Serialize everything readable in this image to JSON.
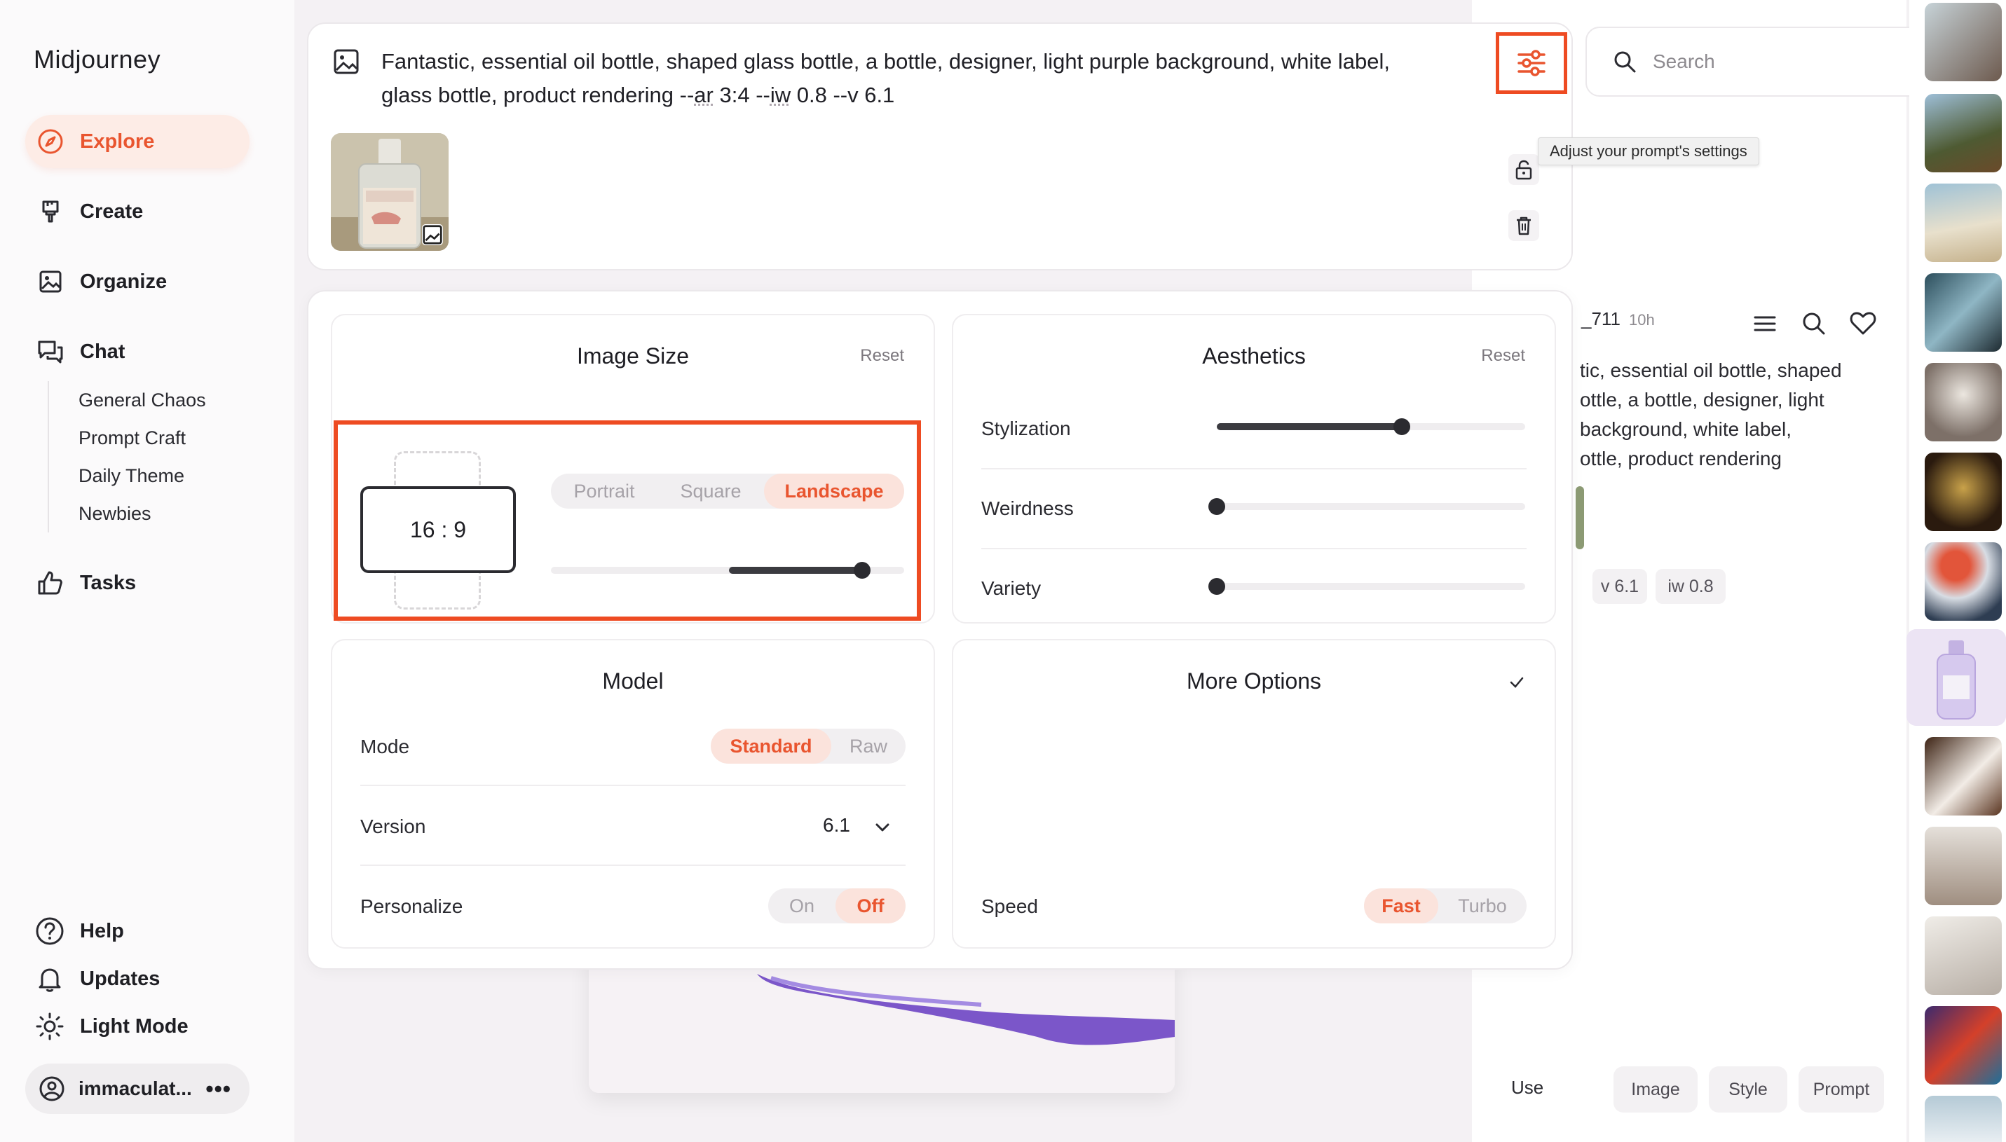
{
  "app": {
    "title": "Midjourney"
  },
  "sidebar": {
    "items": [
      {
        "label": "Explore",
        "icon": "compass-icon",
        "active": true
      },
      {
        "label": "Create",
        "icon": "brush-icon"
      },
      {
        "label": "Organize",
        "icon": "image-icon"
      },
      {
        "label": "Chat",
        "icon": "chat-icon"
      },
      {
        "label": "Tasks",
        "icon": "thumbs-up-icon"
      }
    ],
    "chat_channels": [
      "General Chaos",
      "Prompt Craft",
      "Daily Theme",
      "Newbies"
    ],
    "bottom": [
      {
        "label": "Help",
        "icon": "help-icon"
      },
      {
        "label": "Updates",
        "icon": "bell-icon"
      },
      {
        "label": "Light Mode",
        "icon": "sun-icon"
      }
    ],
    "user": {
      "name": "immaculat...",
      "more": "•••"
    }
  },
  "prompt": {
    "line1": "Fantastic, essential oil bottle, shaped glass bottle, a bottle, designer, light purple background, white label,",
    "line2_a": "glass bottle, product rendering --",
    "line2_ar": "ar",
    "line2_b": " 3:4 --",
    "line2_iw": "iw",
    "line2_c": " 0.8 --v 6.1",
    "tooltip": "Adjust your prompt's settings"
  },
  "search": {
    "placeholder": "Search"
  },
  "image_size": {
    "title": "Image Size",
    "reset": "Reset",
    "ratio": "16 : 9",
    "orientations": [
      "Portrait",
      "Square",
      "Landscape"
    ],
    "selected": "Landscape",
    "slider_value": 0.88
  },
  "aesthetics": {
    "title": "Aesthetics",
    "reset": "Reset",
    "sliders": [
      {
        "label": "Stylization",
        "value": 0.6
      },
      {
        "label": "Weirdness",
        "value": 0.0
      },
      {
        "label": "Variety",
        "value": 0.0
      }
    ]
  },
  "model": {
    "title": "Model",
    "mode_label": "Mode",
    "mode_options": [
      "Standard",
      "Raw"
    ],
    "mode_selected": "Standard",
    "version_label": "Version",
    "version_value": "6.1",
    "personalize_label": "Personalize",
    "personalize_options": [
      "On",
      "Off"
    ],
    "personalize_selected": "Off"
  },
  "more_options": {
    "title": "More Options",
    "speed_label": "Speed",
    "speed_options": [
      "Fast",
      "Turbo"
    ],
    "speed_selected": "Fast"
  },
  "detail": {
    "user_suffix": "_711",
    "time": "10h",
    "prompt_lines": [
      "tic, essential oil bottle, shaped",
      "ottle, a bottle, designer, light",
      "background, white label,",
      "ottle, product rendering"
    ],
    "tags": [
      "v 6.1",
      "iw 0.8"
    ],
    "use_label": "Use",
    "use_buttons": [
      "Image",
      "Style",
      "Prompt"
    ]
  },
  "colors": {
    "accent": "#e9552f",
    "highlight_border": "#ee4b22"
  }
}
